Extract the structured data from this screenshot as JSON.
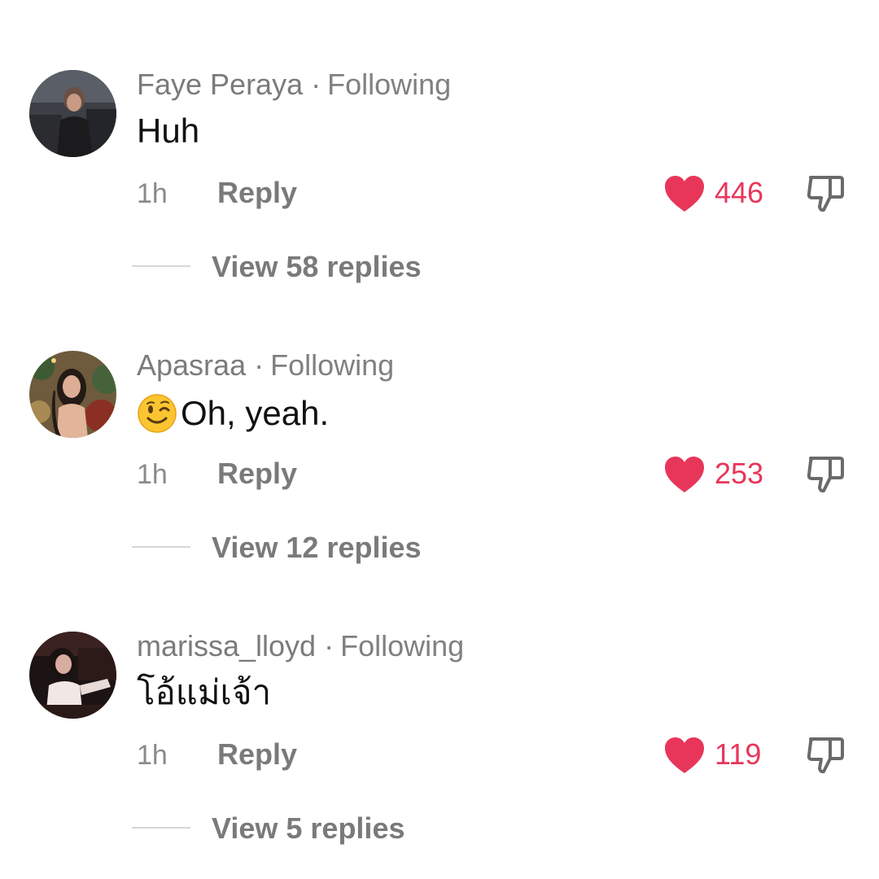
{
  "comments": [
    {
      "username": "Faye Peraya",
      "separator": "·",
      "follow_status": "Following",
      "text": "Huh",
      "emoji": "",
      "time": "1h",
      "reply_label": "Reply",
      "like_count": "446",
      "view_replies": "View 58 replies"
    },
    {
      "username": "Apasraa",
      "separator": "·",
      "follow_status": "Following",
      "text": "Oh, yeah.",
      "emoji": "winking-face",
      "time": "1h",
      "reply_label": "Reply",
      "like_count": "253",
      "view_replies": "View 12 replies"
    },
    {
      "username": "marissa_lloyd",
      "separator": "·",
      "follow_status": "Following",
      "text": "โอ้แม่เจ้า",
      "emoji": "",
      "time": "1h",
      "reply_label": "Reply",
      "like_count": "119",
      "view_replies": "View 5 replies"
    }
  ],
  "colors": {
    "like": "#e8365a",
    "muted_text": "#7a7a7a",
    "body_text": "#111111"
  },
  "icons": {
    "like": "heart-icon",
    "dislike": "thumbs-down-icon",
    "emoji": "winking-face-emoji"
  }
}
